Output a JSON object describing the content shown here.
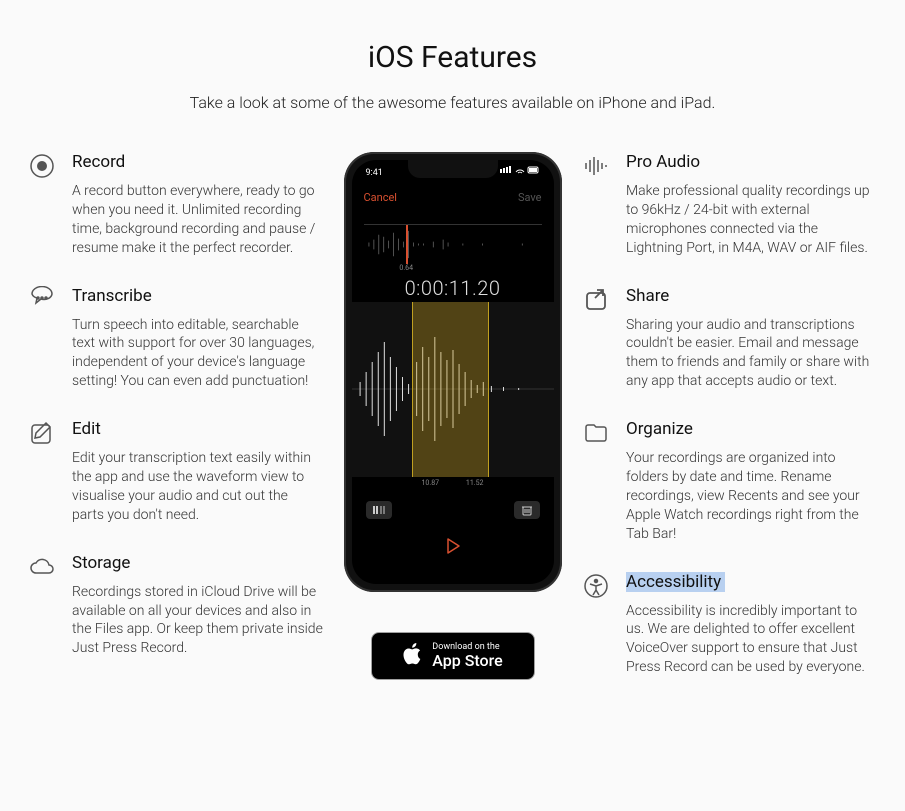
{
  "page": {
    "title": "iOS Features",
    "subtitle": "Take a look at some of the awesome features available on iPhone and iPad."
  },
  "features_left": [
    {
      "title": "Record",
      "desc": "A record button everywhere, ready to go when you need it. Unlimited recording time, background recording and pause / resume make it the perfect recorder."
    },
    {
      "title": "Transcribe",
      "desc": "Turn speech into editable, searchable text with support for over 30 languages, independent of your device's language setting! You can even add punctuation!"
    },
    {
      "title": "Edit",
      "desc": "Edit your transcription text easily within the app and use the waveform view to visualise your audio and cut out the parts you don't need."
    },
    {
      "title": "Storage",
      "desc": "Recordings stored in iCloud Drive will be available on all your devices and also in the Files app.  Or keep them private inside Just Press Record."
    }
  ],
  "features_right": [
    {
      "title": "Pro Audio",
      "desc": "Make professional quality recordings up to 96kHz / 24-bit with external microphones connected via the Lightning Port, in M4A, WAV or AIF files."
    },
    {
      "title": "Share",
      "desc": "Sharing your audio and transcriptions couldn't be easier.  Email and message them to friends and family or share with any app that accepts audio or text."
    },
    {
      "title": "Organize",
      "desc": "Your recordings are organized into folders by date and time.  Rename recordings, view Recents and see your Apple Watch recordings right from the Tab Bar!"
    },
    {
      "title": "Accessibility",
      "desc": "Accessibility is incredibly important to us.  We are delighted to offer excellent VoiceOver support to ensure that Just Press Record can be used by everyone."
    }
  ],
  "phone": {
    "time": "9:41",
    "cancel": "Cancel",
    "save": "Save",
    "marker": "0.64",
    "timer": "0:00:11.20",
    "sel_start": "10.87",
    "sel_end": "11.52"
  },
  "badge": {
    "small": "Download on the",
    "large": "App Store"
  }
}
